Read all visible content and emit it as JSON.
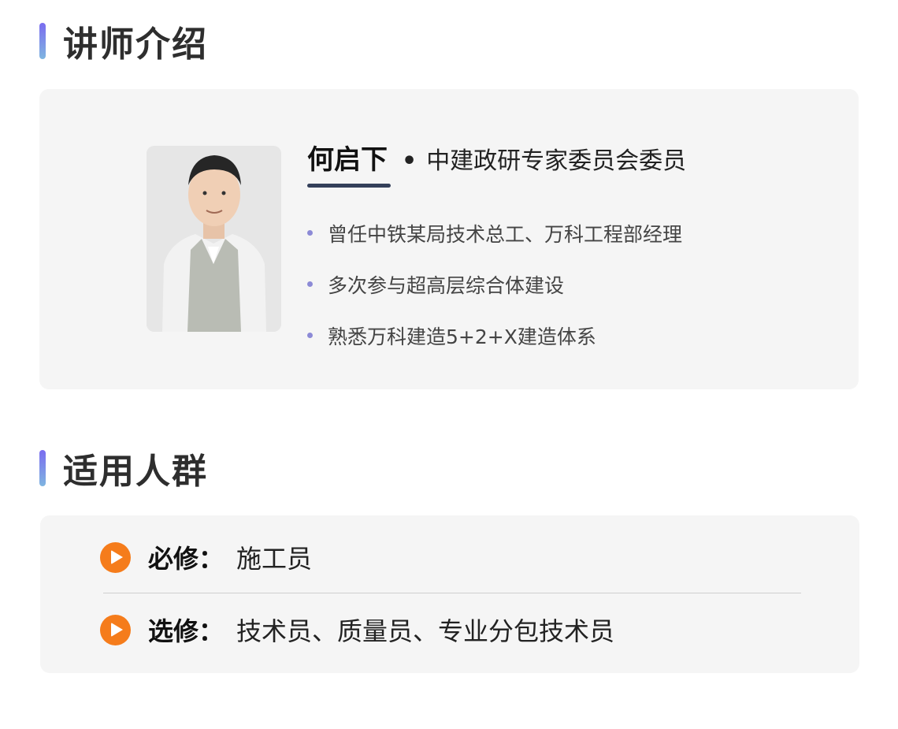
{
  "lecturer_section": {
    "title": "讲师介绍",
    "name": "何启下",
    "separator": "•",
    "role": "中建政研专家委员会委员",
    "bullets": [
      "曾任中铁某局技术总工、万科工程部经理",
      "多次参与超高层综合体建设",
      "熟悉万科建造5+2+X建造体系"
    ]
  },
  "audience_section": {
    "title": "适用人群",
    "required": {
      "label": "必修：",
      "value": "施工员"
    },
    "optional": {
      "label": "选修：",
      "value": "技术员、质量员、专业分包技术员"
    }
  },
  "colors": {
    "accent_gradient_top": "#7a6cf0",
    "accent_gradient_bottom": "#7fb5e0",
    "play_icon": "#f57c1b",
    "bullet_dot": "#8c8ad6",
    "name_underline": "#34405a",
    "card_background": "#f5f5f5"
  },
  "icons": {
    "section_marker": "vertical-bar-icon",
    "audience_marker": "play-circle-icon"
  }
}
